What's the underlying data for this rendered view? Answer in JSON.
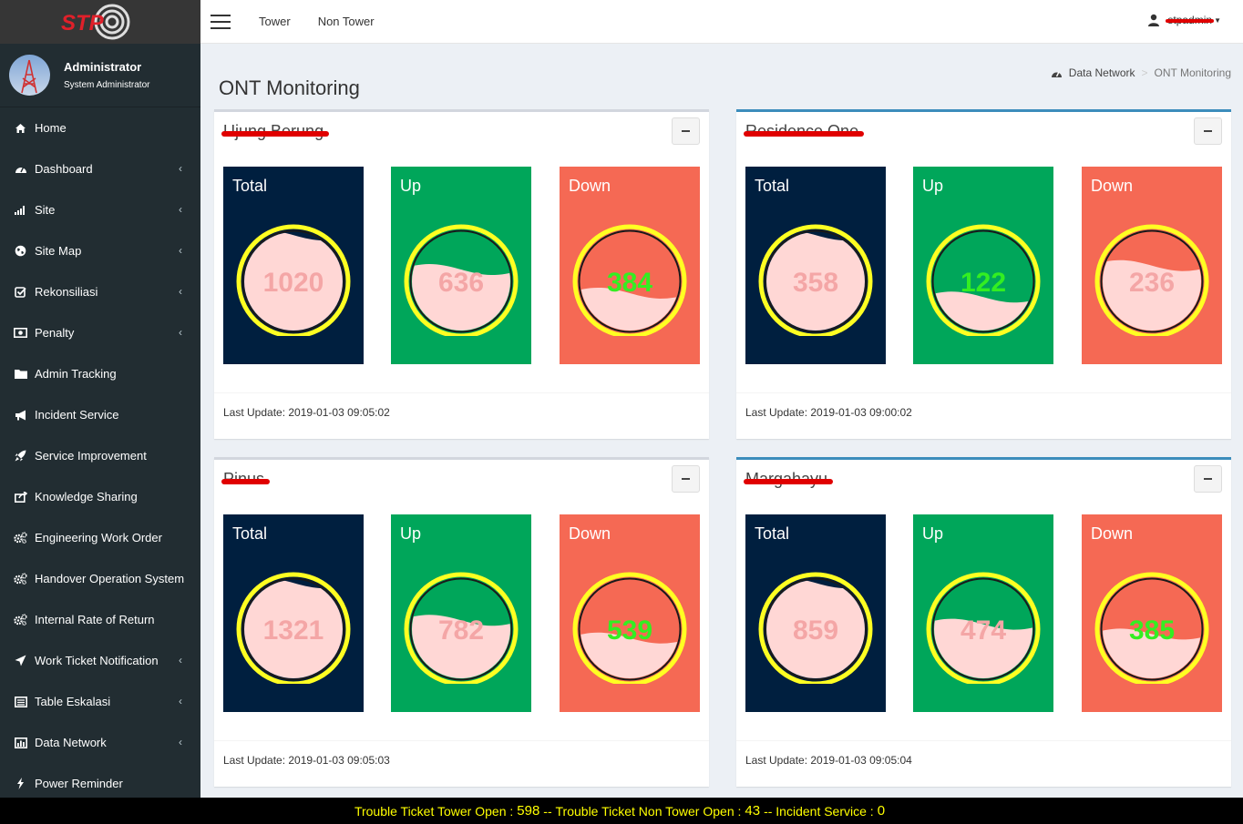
{
  "brand": {
    "logo_text": "STP"
  },
  "user": {
    "name": "Administrator",
    "role": "System Administrator"
  },
  "sidebar": {
    "items": [
      {
        "label": "Home",
        "icon": "home-icon",
        "has_submenu": false
      },
      {
        "label": "Dashboard",
        "icon": "dashboard-icon",
        "has_submenu": true
      },
      {
        "label": "Site",
        "icon": "signal-icon",
        "has_submenu": true
      },
      {
        "label": "Site Map",
        "icon": "globe-icon",
        "has_submenu": true
      },
      {
        "label": "Rekonsiliasi",
        "icon": "check-square-icon",
        "has_submenu": true
      },
      {
        "label": "Penalty",
        "icon": "money-icon",
        "has_submenu": true
      },
      {
        "label": "Admin Tracking",
        "icon": "folder-icon",
        "has_submenu": false
      },
      {
        "label": "Incident Service",
        "icon": "bullhorn-icon",
        "has_submenu": false
      },
      {
        "label": "Service Improvement",
        "icon": "rocket-icon",
        "has_submenu": false
      },
      {
        "label": "Knowledge Sharing",
        "icon": "share-icon",
        "has_submenu": false
      },
      {
        "label": "Engineering Work Order",
        "icon": "cogs-icon",
        "has_submenu": false
      },
      {
        "label": "Handover Operation System",
        "icon": "cogs-icon",
        "has_submenu": false
      },
      {
        "label": "Internal Rate of Return",
        "icon": "cogs-icon",
        "has_submenu": false
      },
      {
        "label": "Work Ticket Notification",
        "icon": "send-icon",
        "has_submenu": true
      },
      {
        "label": "Table Eskalasi",
        "icon": "list-icon",
        "has_submenu": true
      },
      {
        "label": "Data Network",
        "icon": "chart-icon",
        "has_submenu": true
      },
      {
        "label": "Power Reminder",
        "icon": "bolt-icon",
        "has_submenu": false
      }
    ]
  },
  "topnav": {
    "links": [
      "Tower",
      "Non Tower"
    ],
    "user_label": "stpadmin"
  },
  "page": {
    "title": "ONT Monitoring"
  },
  "breadcrumb": {
    "parent": "Data Network",
    "current": "ONT Monitoring",
    "icon": "dashboard-icon"
  },
  "labels": {
    "total": "Total",
    "up": "Up",
    "down": "Down"
  },
  "colors": {
    "total": "#001f3f",
    "up": "#00a65a",
    "down": "#f56954",
    "ring": "#ffff22",
    "liquid": "#ffd7d5",
    "accent_text": "#33ee22",
    "faded_text": "#f4a6a6"
  },
  "panels": [
    {
      "name": "Ujung Berung",
      "redacted": true,
      "total": 1020,
      "up": 636,
      "down": 384,
      "up_fill": 0.62,
      "down_fill": 0.38,
      "last_update": "Last Update: 2019-01-03 09:05:02"
    },
    {
      "name": "Residence One",
      "redacted": true,
      "total": 358,
      "up": 122,
      "down": 236,
      "up_fill": 0.34,
      "down_fill": 0.66,
      "last_update": "Last Update: 2019-01-03 09:00:02"
    },
    {
      "name": "Pinus",
      "redacted": true,
      "total": 1321,
      "up": 782,
      "down": 539,
      "up_fill": 0.59,
      "down_fill": 0.41,
      "last_update": "Last Update: 2019-01-03 09:05:03"
    },
    {
      "name": "Margahayu",
      "redacted": true,
      "total": 859,
      "up": 474,
      "down": 385,
      "up_fill": 0.55,
      "down_fill": 0.45,
      "last_update": "Last Update: 2019-01-03 09:05:04"
    }
  ],
  "ticker": {
    "label_1": "Trouble Ticket Tower Open :",
    "value_1": "598",
    "sep_1": "--",
    "label_2": "Trouble Ticket Non Tower Open :",
    "value_2": "43",
    "sep_2": "--",
    "label_3": "Incident Service :",
    "value_3": "0"
  }
}
